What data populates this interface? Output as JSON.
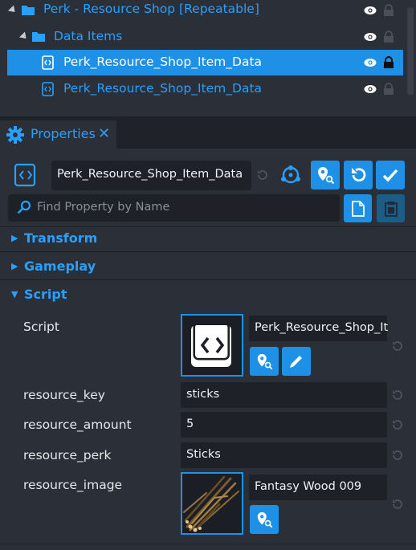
{
  "hierarchy": {
    "rows": [
      {
        "label": "Perk - Resource Shop [Repeatable]"
      },
      {
        "label": "Data Items"
      },
      {
        "label": "Perk_Resource_Shop_Item_Data"
      },
      {
        "label": "Perk_Resource_Shop_Item_Data"
      }
    ]
  },
  "tab": {
    "label": "Properties",
    "close": "✕"
  },
  "header": {
    "name_value": "Perk_Resource_Shop_Item_Data"
  },
  "search": {
    "placeholder": "Find Property by Name"
  },
  "sections": {
    "transform": "Transform",
    "gameplay": "Gameplay",
    "script": "Script"
  },
  "script": {
    "script_label": "Script",
    "script_value": "Perk_Resource_Shop_It",
    "props": [
      {
        "label": "resource_key",
        "value": "sticks"
      },
      {
        "label": "resource_amount",
        "value": "5"
      },
      {
        "label": "resource_perk",
        "value": "Sticks"
      }
    ],
    "image_label": "resource_image",
    "image_value": "Fantasy Wood 009"
  },
  "colors": {
    "accent": "#1e90e6",
    "link": "#28a0ff",
    "panel": "#2b2f37",
    "field": "#1e2128"
  }
}
